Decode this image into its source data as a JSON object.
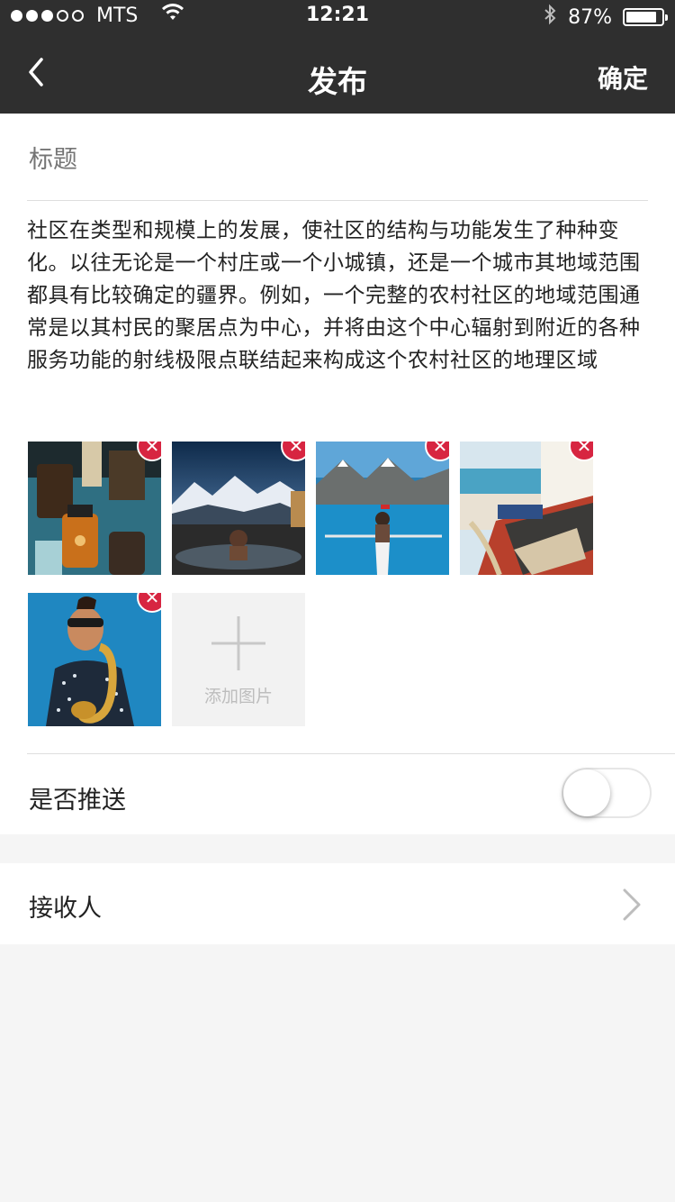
{
  "status_bar": {
    "carrier": "MTS",
    "time": "12:21",
    "battery_percent": "87%",
    "battery_level": 0.87,
    "signal_dots_filled": 3,
    "signal_dots_total": 5,
    "icons": [
      "wifi-icon",
      "bluetooth-icon",
      "battery-icon"
    ]
  },
  "nav": {
    "back_icon": "chevron-left-icon",
    "title": "发布",
    "confirm_label": "确定"
  },
  "form": {
    "title_placeholder": "标题",
    "body": "社区在类型和规模上的发展，使社区的结构与功能发生了种种变化。以往无论是一个村庄或一个小城镇，还是一个城市其地域范围都具有比较确定的疆界。例如，一个完整的农村社区的地域范围通常是以其村民的聚居点为中心，并将由这个中心辐射到附近的各种服务功能的射线极限点联结起来构成这个农村社区的地理区域"
  },
  "photos": {
    "items": [
      {
        "subject": "apothecary-bottles"
      },
      {
        "subject": "hot-spring-mountains"
      },
      {
        "subject": "kayak-lake"
      },
      {
        "subject": "beach-boat"
      },
      {
        "subject": "saxophone-player"
      }
    ],
    "remove_icon": "close-icon",
    "add_label": "添加图片"
  },
  "push": {
    "label": "是否推送",
    "enabled": false
  },
  "receiver": {
    "label": "接收人",
    "icon": "chevron-right-icon"
  },
  "colors": {
    "header_bg": "#2f2f2f",
    "delete_badge": "#d72541",
    "page_bg": "#f5f5f5"
  }
}
